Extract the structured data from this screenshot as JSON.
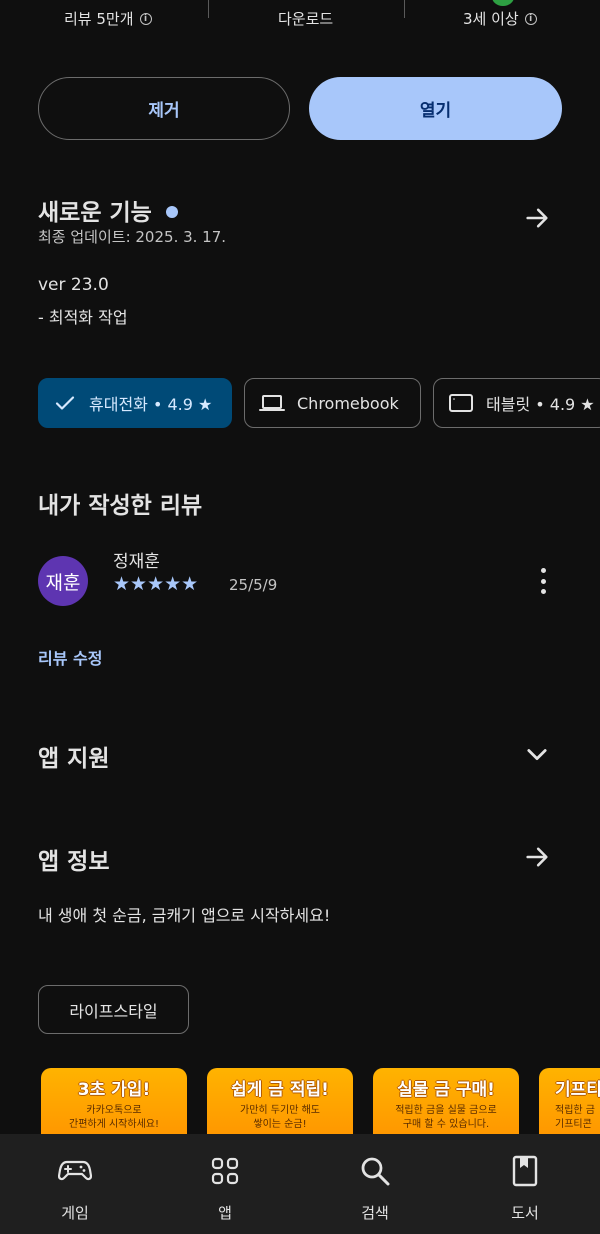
{
  "stats": {
    "reviews": "리뷰 5만개",
    "downloads": "다운로드",
    "age_rating": "3세 이상"
  },
  "actions": {
    "remove_label": "제거",
    "open_label": "열기"
  },
  "whats_new": {
    "title": "새로운 기능",
    "last_updated": "최종 업데이트: 2025. 3. 17.",
    "version": "ver 23.0",
    "notes": "- 최적화 작업"
  },
  "device_chips": [
    {
      "label": "휴대전화 • 4.9 ★",
      "icon": "check-icon",
      "selected": true
    },
    {
      "label": "Chromebook",
      "icon": "laptop-icon",
      "selected": false
    },
    {
      "label": "태블릿 • 4.9 ★",
      "icon": "tablet-icon",
      "selected": false
    }
  ],
  "my_review": {
    "title": "내가 작성한 리뷰",
    "avatar_text": "재훈",
    "reviewer_name": "정재훈",
    "rating": 5,
    "stars": "★★★★★",
    "date": "25/5/9",
    "edit_label": "리뷰 수정"
  },
  "app_support": {
    "title": "앱 지원"
  },
  "app_info": {
    "title": "앱 정보",
    "description": "내 생애 첫 순금, 금캐기 앱으로 시작하세요!",
    "category": "라이프스타일"
  },
  "screenshots": [
    {
      "title": "3초 가입!",
      "line1": "카카오톡으로",
      "line2": "간편하게 시작하세요!"
    },
    {
      "title": "쉽게 금 적립!",
      "line1": "가만히 두기만 해도",
      "line2": "쌓이는 순금!"
    },
    {
      "title": "실물 금 구매!",
      "line1": "적립한 금을 실물 금으로",
      "line2": "구매 할 수 있습니다."
    },
    {
      "title": "기프티",
      "line1": "적립한 금",
      "line2": "기프티콘"
    }
  ],
  "bottom_nav": [
    {
      "label": "게임",
      "icon": "gamepad-icon"
    },
    {
      "label": "앱",
      "icon": "apps-grid-icon"
    },
    {
      "label": "검색",
      "icon": "search-icon"
    },
    {
      "label": "도서",
      "icon": "book-icon"
    }
  ],
  "colors": {
    "background": "#0f0f0f",
    "accent": "#a8c7fa",
    "chip_selected": "#004a77",
    "avatar": "#5e35b1",
    "nav_background": "#1f1f1f"
  }
}
